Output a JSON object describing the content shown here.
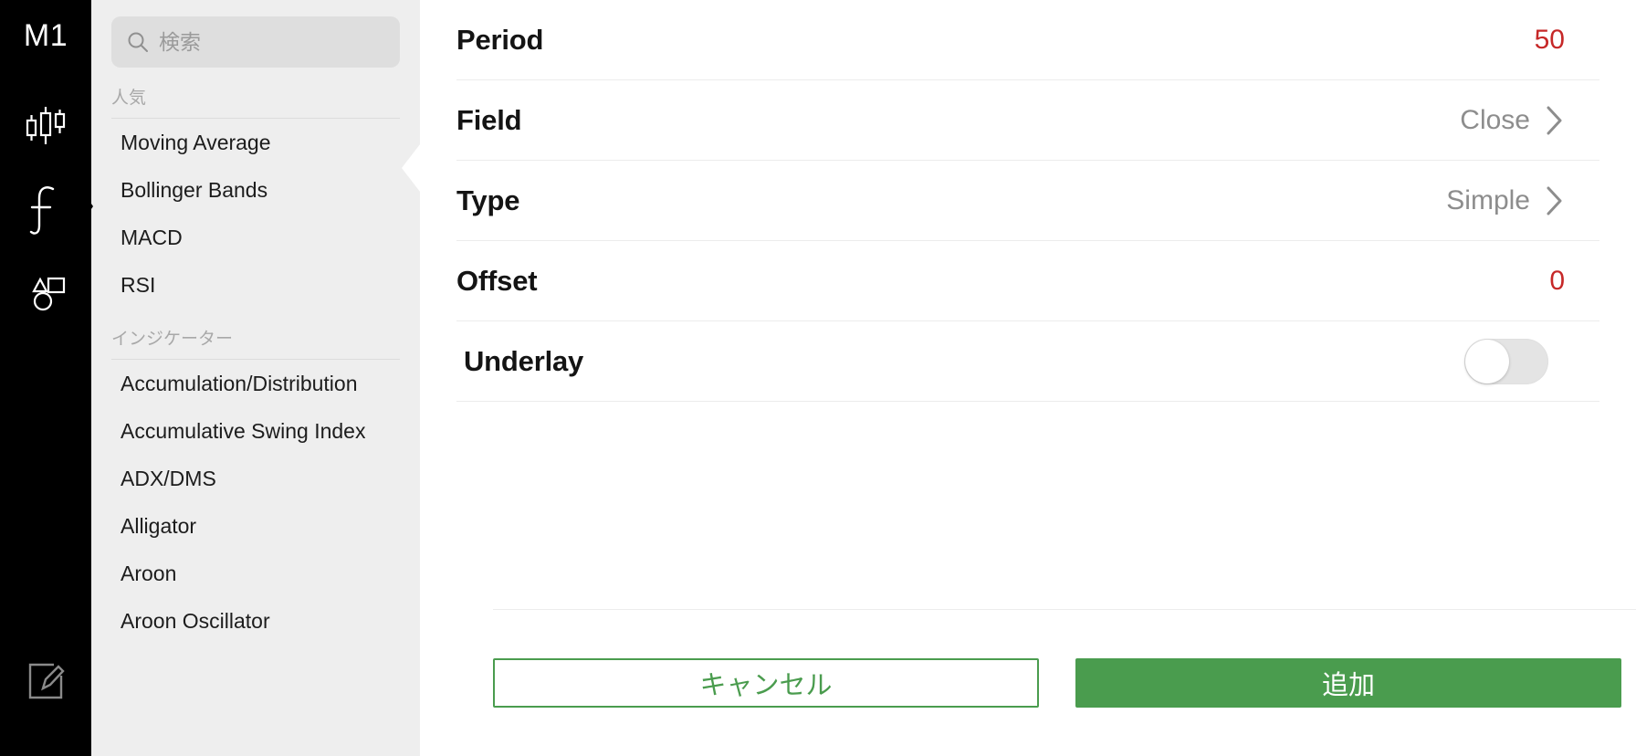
{
  "rail": {
    "timeframe": "M1",
    "buttons": [
      {
        "name": "candlestick-chart-icon",
        "label": "chart-type"
      },
      {
        "name": "function-indicator-icon",
        "label": "indicators"
      },
      {
        "name": "drawing-tools-icon",
        "label": "drawing-tools"
      },
      {
        "name": "edit-icon",
        "label": "edit"
      }
    ]
  },
  "search": {
    "placeholder": "検索",
    "value": "",
    "icon": "search-icon"
  },
  "list": {
    "popular_header": "人気",
    "popular": [
      "Moving Average",
      "Bollinger Bands",
      "MACD",
      "RSI"
    ],
    "indicators_header": "インジケーター",
    "indicators": [
      "Accumulation/Distribution",
      "Accumulative Swing Index",
      "ADX/DMS",
      "Alligator",
      "Aroon",
      "Aroon Oscillator"
    ]
  },
  "settings": {
    "rows": [
      {
        "label": "Period",
        "value": "50",
        "kind": "number"
      },
      {
        "label": "Field",
        "value": "Close",
        "kind": "select"
      },
      {
        "label": "Type",
        "value": "Simple",
        "kind": "select"
      },
      {
        "label": "Offset",
        "value": "0",
        "kind": "number"
      },
      {
        "label": "Underlay",
        "value": "off",
        "kind": "toggle"
      }
    ]
  },
  "actions": {
    "cancel_label": "キャンセル",
    "add_label": "追加"
  },
  "colors": {
    "accent_green": "#4a9c4e",
    "value_red": "#c62828",
    "rail_bg": "#000000",
    "panel_bg": "#eeeeee",
    "muted_text": "#8d8d8d"
  }
}
